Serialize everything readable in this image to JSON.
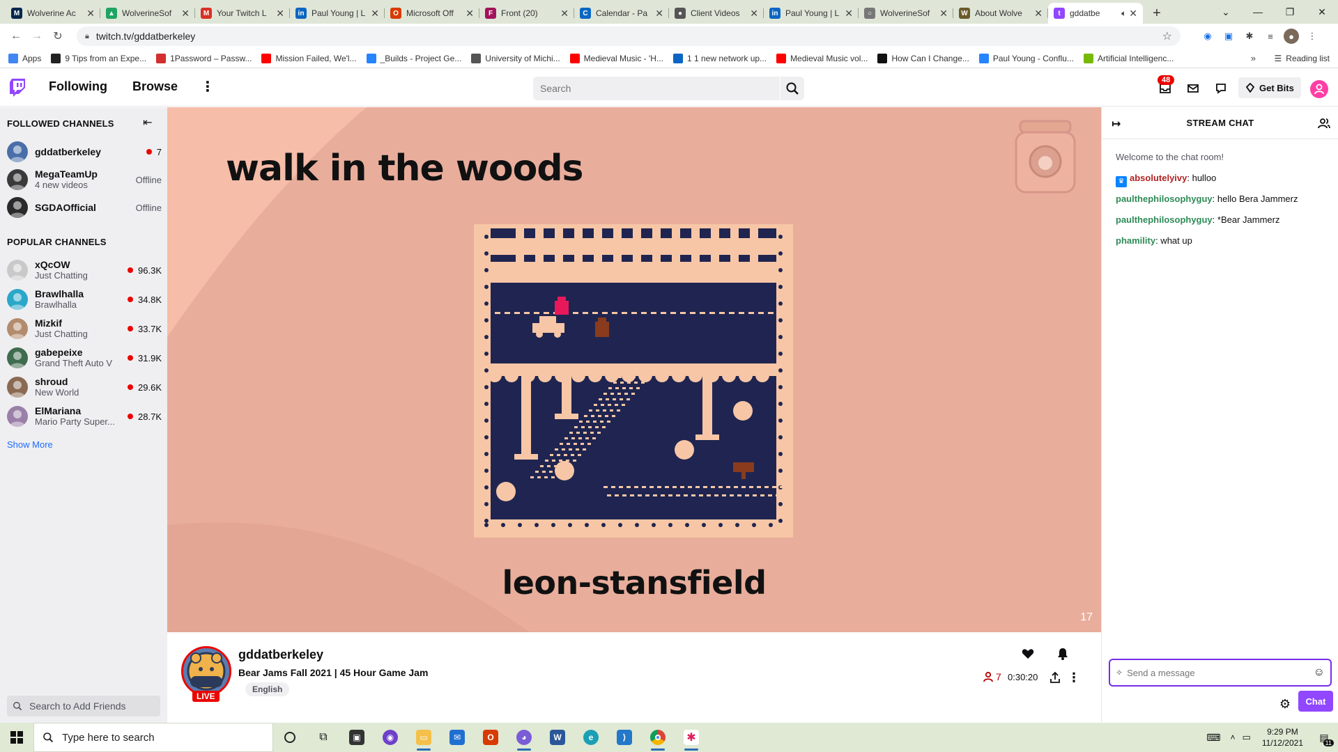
{
  "browser": {
    "tabs": [
      {
        "title": "Wolverine Ac",
        "color": "#00274c",
        "glyph": "M"
      },
      {
        "title": "WolverineSof",
        "color": "#1fa463",
        "glyph": "▲"
      },
      {
        "title": "Your Twitch L",
        "color": "#d93025",
        "glyph": "M"
      },
      {
        "title": "Paul Young | L",
        "color": "#0a66c2",
        "glyph": "in"
      },
      {
        "title": "Microsoft Off",
        "color": "#d83b01",
        "glyph": "O"
      },
      {
        "title": "Front (20)",
        "color": "#a3135b",
        "glyph": "F"
      },
      {
        "title": "Calendar - Pa",
        "color": "#0a66c2",
        "glyph": "C"
      },
      {
        "title": "Client Videos",
        "color": "#555555",
        "glyph": "●"
      },
      {
        "title": "Paul Young | L",
        "color": "#0a66c2",
        "glyph": "in"
      },
      {
        "title": "WolverineSof",
        "color": "#777777",
        "glyph": "○"
      },
      {
        "title": "About Wolve",
        "color": "#6b5a2a",
        "glyph": "W"
      },
      {
        "title": "gddatbe",
        "color": "#9147ff",
        "glyph": "t"
      }
    ],
    "url": "twitch.tv/gddatberkeley",
    "bookmarks": [
      {
        "label": "Apps",
        "color": "#4285f4"
      },
      {
        "label": "9 Tips from an Expe...",
        "color": "#222222"
      },
      {
        "label": "1Password – Passw...",
        "color": "#d32f2f"
      },
      {
        "label": "Mission Failed, We'l...",
        "color": "#ff0000"
      },
      {
        "label": "_Builds - Project Ge...",
        "color": "#2684ff"
      },
      {
        "label": "University of Michi...",
        "color": "#555555"
      },
      {
        "label": "Medieval Music - 'H...",
        "color": "#ff0000"
      },
      {
        "label": "1 1 new network up...",
        "color": "#0a66c2"
      },
      {
        "label": "Medieval Music vol...",
        "color": "#ff0000"
      },
      {
        "label": "How Can I Change...",
        "color": "#111111"
      },
      {
        "label": "Paul Young - Conflu...",
        "color": "#2684ff"
      },
      {
        "label": "Artificial Intelligenc...",
        "color": "#76b900"
      }
    ],
    "reading_list": "Reading list"
  },
  "topnav": {
    "following": "Following",
    "browse": "Browse",
    "search_placeholder": "Search",
    "notifications_count": "48",
    "get_bits": "Get Bits"
  },
  "sidebar": {
    "followed_header": "FOLLOWED CHANNELS",
    "followed": [
      {
        "name": "gddatberkeley",
        "sub": "",
        "status": "7",
        "live": true,
        "avatar": "#4a6fa8"
      },
      {
        "name": "MegaTeamUp",
        "sub": "4 new videos",
        "status": "Offline",
        "live": false,
        "avatar": "#3a3a3a"
      },
      {
        "name": "SGDAOfficial",
        "sub": "",
        "status": "Offline",
        "live": false,
        "avatar": "#2a2a2a"
      }
    ],
    "popular_header": "POPULAR CHANNELS",
    "popular": [
      {
        "name": "xQcOW",
        "sub": "Just Chatting",
        "status": "96.3K",
        "avatar": "#c9c9c9"
      },
      {
        "name": "Brawlhalla",
        "sub": "Brawlhalla",
        "status": "34.8K",
        "avatar": "#2aa7c9"
      },
      {
        "name": "Mizkif",
        "sub": "Just Chatting",
        "status": "33.7K",
        "avatar": "#b38b6d"
      },
      {
        "name": "gabepeixe",
        "sub": "Grand Theft Auto V",
        "status": "31.9K",
        "avatar": "#3f6b4e"
      },
      {
        "name": "shroud",
        "sub": "New World",
        "status": "29.6K",
        "avatar": "#8a6a52"
      },
      {
        "name": "ElMariana",
        "sub": "Mario Party Super...",
        "status": "28.7K",
        "avatar": "#9a7fa8"
      }
    ],
    "show_more": "Show More",
    "friends_search": "Search to Add Friends"
  },
  "player": {
    "title": "walk in the woods",
    "author": "leon-stansfield",
    "frame_number": "17",
    "bg_color": "#e9ad9c",
    "game_bg": "#1f2550",
    "game_fg": "#f7c6a6"
  },
  "info": {
    "channel": "gddatberkeley",
    "live_label": "LIVE",
    "stream_title": "Bear Jams Fall 2021 | 45 Hour Game Jam",
    "tag": "English",
    "viewers": "7",
    "uptime": "0:30:20"
  },
  "chat": {
    "header": "STREAM CHAT",
    "welcome": "Welcome to the chat room!",
    "messages": [
      {
        "user": "absolutelyivy",
        "text": ": hulloo",
        "color": "#b22222",
        "badge": true
      },
      {
        "user": "paulthephilosophyguy",
        "text": ": hello Bera Jammerz",
        "color": "#2e8b57",
        "badge": false
      },
      {
        "user": "paulthephilosophyguy",
        "text": ": *Bear Jammerz",
        "color": "#2e8b57",
        "badge": false
      },
      {
        "user": "phamility",
        "text": ": what up",
        "color": "#2e8b57",
        "badge": false
      }
    ],
    "input_placeholder": "Send a message",
    "send_label": "Chat"
  },
  "taskbar": {
    "search_placeholder": "Type here to search",
    "time": "9:29 PM",
    "date": "11/12/2021",
    "notification_count": "11"
  }
}
